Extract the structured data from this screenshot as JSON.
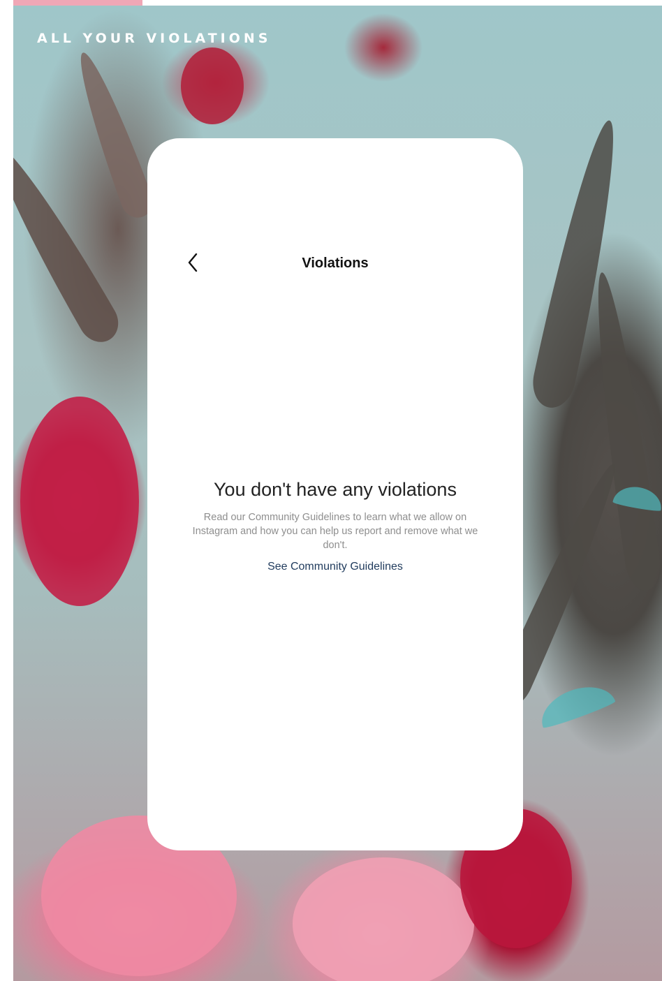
{
  "overlay": {
    "title": "ALL YOUR VIOLATIONS"
  },
  "screen": {
    "nav": {
      "back_icon": "chevron-left-icon",
      "title": "Violations"
    },
    "empty_state": {
      "heading": "You don't have any violations",
      "body": "Read our Community Guidelines to learn what we allow on Instagram and how you can help us report and remove what we don't.",
      "link": "See Community Guidelines"
    }
  },
  "colors": {
    "accent_strip": "#f0a7b6",
    "link": "#1f3a5c",
    "body_text": "#8e8e8e",
    "heading_text": "#222222"
  }
}
